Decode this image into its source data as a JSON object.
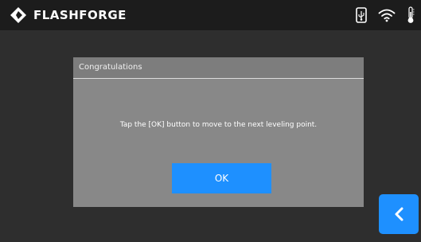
{
  "topbar": {
    "brand_name": "FLASHFORGE",
    "icons": [
      "flashforge-logo-icon",
      "usb-drive-icon",
      "wifi-icon",
      "thermometer-icon"
    ]
  },
  "dialog": {
    "title": "Congratulations",
    "message": "Tap the [OK] button to move to the next leveling point.",
    "ok_label": "OK"
  },
  "nav": {
    "back_icon": "chevron-left-icon"
  },
  "colors": {
    "topbar_bg": "#1c1c1c",
    "screen_bg": "#2e2e2e",
    "dialog_bg": "#888888",
    "accent": "#1e90ff",
    "text": "#ffffff"
  }
}
